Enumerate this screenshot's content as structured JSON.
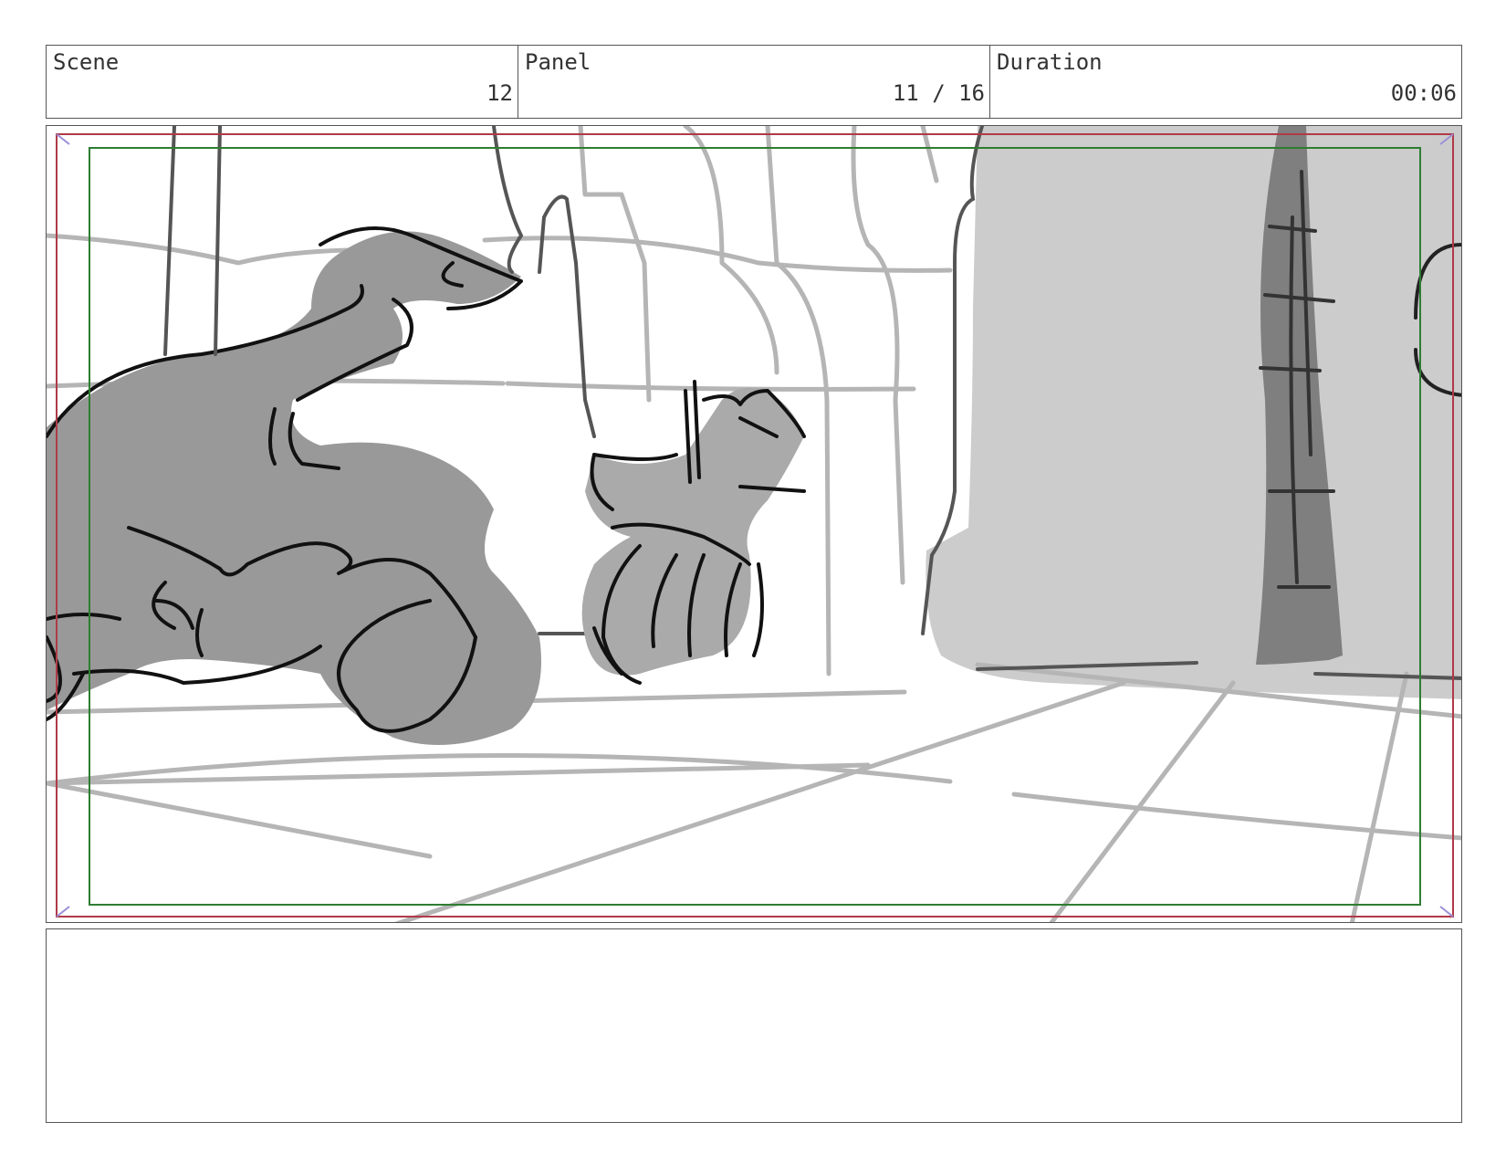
{
  "header": {
    "scene": {
      "label": "Scene",
      "value": "12"
    },
    "panel": {
      "label": "Panel",
      "value": "11 / 16"
    },
    "duration": {
      "label": "Duration",
      "value": "00:06"
    }
  },
  "panel_image": {
    "frame_colors": {
      "outer_safe": "#b03a48",
      "inner_safe": "#2e7d32",
      "corner_marks": "#9a8fd6"
    }
  },
  "notes": {
    "text": ""
  }
}
